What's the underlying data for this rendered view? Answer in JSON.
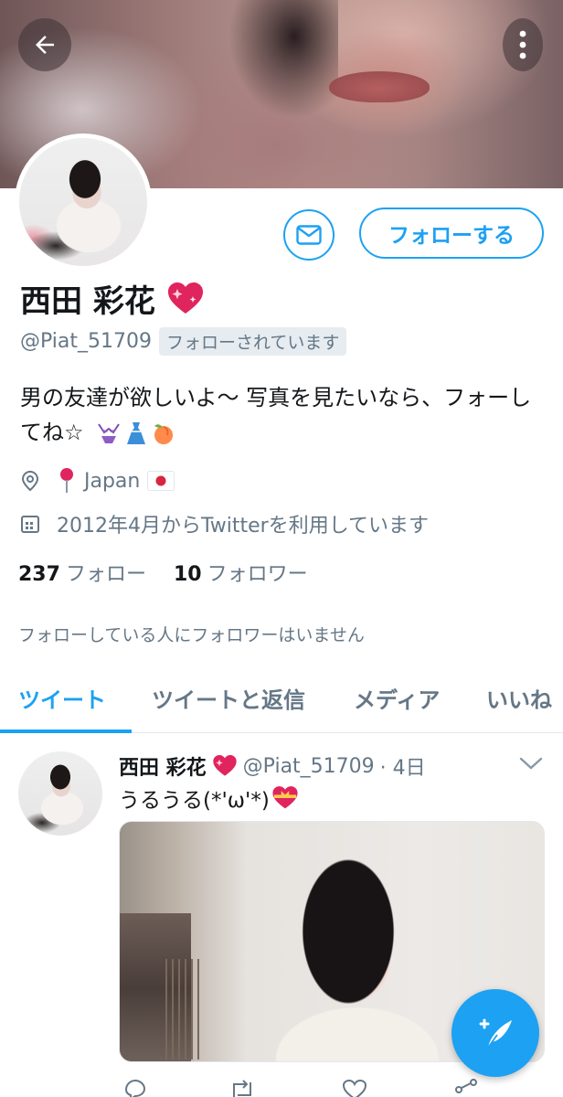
{
  "profile": {
    "name": "西田 彩花",
    "handle": "@Piat_51709",
    "follows_you_badge": "フォローされています",
    "bio_text": "男の友達が欲しいよ〜 写真を見たいなら、フォーしてね☆",
    "location": "Japan",
    "joined": "2012年4月からTwitterを利用しています",
    "following_count": "237",
    "following_label": "フォロー",
    "followers_count": "10",
    "followers_label": "フォロワー",
    "no_common_followers": "フォローしている人にフォロワーはいません"
  },
  "actions": {
    "follow_label": "フォローする"
  },
  "tabs": [
    {
      "label": "ツイート",
      "active": true
    },
    {
      "label": "ツイートと返信",
      "active": false
    },
    {
      "label": "メディア",
      "active": false
    },
    {
      "label": "いいね",
      "active": false
    }
  ],
  "tweet": {
    "author_name": "西田 彩花",
    "author_handle": "@Piat_51709",
    "time": "· 4日",
    "text": "うるうる(*'ω'*)"
  },
  "colors": {
    "accent": "#1da1f2",
    "text_primary": "#14171a",
    "text_secondary": "#657786",
    "divider": "#e1e8ed"
  },
  "icons": {
    "back": "arrow-left-icon",
    "more": "more-vertical-icon",
    "message": "envelope-icon",
    "location": "location-pin-icon",
    "calendar": "calendar-icon",
    "compose": "compose-tweet-icon",
    "caret": "chevron-down-icon"
  }
}
